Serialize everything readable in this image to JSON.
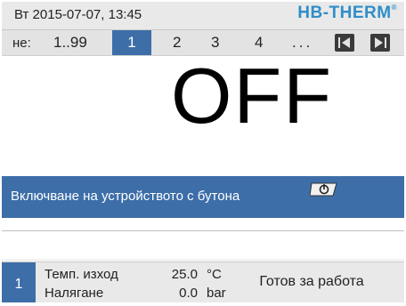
{
  "header": {
    "datetime": "Вт 2015-07-07, 13:45",
    "logo": "HB-THERM",
    "logo_mark": "®"
  },
  "tabs": {
    "prefix": "не:",
    "range": "1..99",
    "items": [
      "1",
      "2",
      "3",
      "4"
    ],
    "selected": "1",
    "ellipsis": "...",
    "nav_prev_icon": "skip-previous-icon",
    "nav_next_icon": "skip-next-icon"
  },
  "main": {
    "state": "OFF",
    "message": "Включване на устройството с бутона",
    "message_icon": "power-button-icon"
  },
  "footer": {
    "unit_index": "1",
    "rows": [
      {
        "label": "Темп. изход",
        "value": "25.0",
        "unit": "°C"
      },
      {
        "label": "Налягане",
        "value": "0.0",
        "unit": "bar"
      }
    ],
    "status": "Готов за работа"
  },
  "colors": {
    "accent": "#3d6ea8",
    "logo": "#2f8ec8",
    "panel": "#e9e9e9"
  }
}
